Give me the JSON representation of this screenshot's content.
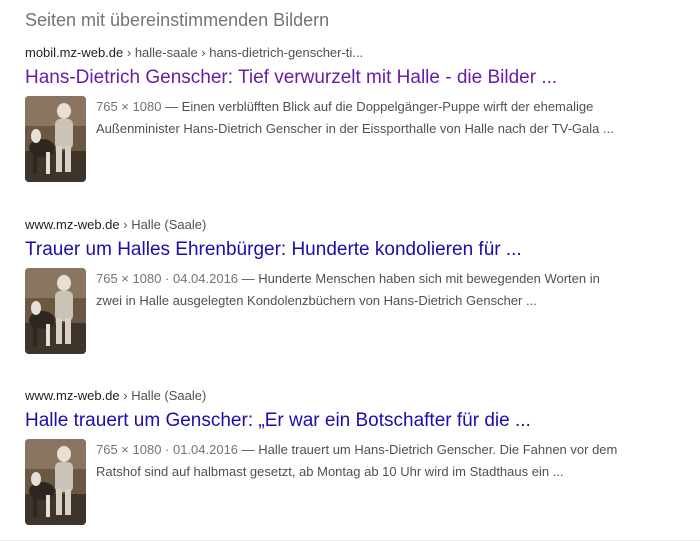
{
  "section": {
    "title": "Seiten mit übereinstimmenden Bildern"
  },
  "results": [
    {
      "breadcrumb_domain": "mobil.mz-web.de",
      "breadcrumb_path": " › halle-saale › hans-dietrich-genscher-ti...",
      "title": "Hans-Dietrich Genscher: Tief verwurzelt mit Halle - die Bilder ...",
      "visited": true,
      "meta": "765 × 1080",
      "snippet": " — Einen verblüfften Blick auf die Doppelgänger-Puppe wirft der ehemalige Außenminister Hans-Dietrich Genscher in der Eissporthalle von Halle nach der TV-Gala ...",
      "thumbnail_icon": "boy-with-dog-photo"
    },
    {
      "breadcrumb_domain": "www.mz-web.de",
      "breadcrumb_path": " › Halle (Saale)",
      "title": "Trauer um Halles Ehrenbürger: Hunderte kondolieren für ...",
      "visited": false,
      "meta": "765 × 1080 · 04.04.2016",
      "snippet": " — Hunderte Menschen haben sich mit bewegenden Worten in zwei in Halle ausgelegten Kondolenzbüchern von Hans-Dietrich Genscher ...",
      "thumbnail_icon": "boy-with-dog-photo"
    },
    {
      "breadcrumb_domain": "www.mz-web.de",
      "breadcrumb_path": " › Halle (Saale)",
      "title": "Halle trauert um Genscher: „Er war ein Botschafter für die ...",
      "visited": false,
      "meta": "765 × 1080 · 01.04.2016",
      "snippet": " — Halle trauert um Hans-Dietrich Genscher. Die Fahnen vor dem Ratshof sind auf halbmast gesetzt, ab Montag ab 10 Uhr wird im Stadthaus ein ...",
      "thumbnail_icon": "boy-with-dog-photo"
    }
  ],
  "colors": {
    "link_visited": "#681da8",
    "link_unvisited": "#1a0dab",
    "snippet_text": "#4d5156",
    "meta_text": "#70757a"
  }
}
